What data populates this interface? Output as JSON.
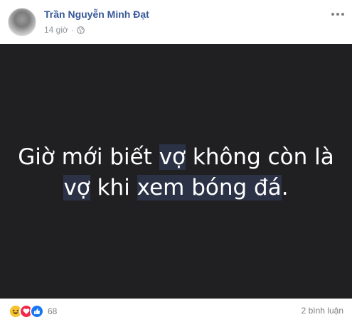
{
  "post": {
    "author": "Trần Nguyễn Minh Đạt",
    "time": "14 giờ",
    "privacy_icon": "globe-icon",
    "image_text": {
      "line1": [
        "Giờ mới biết ",
        "vợ",
        " không còn là"
      ],
      "line2": [
        "vợ",
        " khi ",
        "xem bóng đá",
        "."
      ]
    }
  },
  "footer": {
    "reaction_icons": [
      "haha-icon",
      "love-icon",
      "like-icon"
    ],
    "reaction_count": "68",
    "comment_count": "2 bình luận"
  }
}
